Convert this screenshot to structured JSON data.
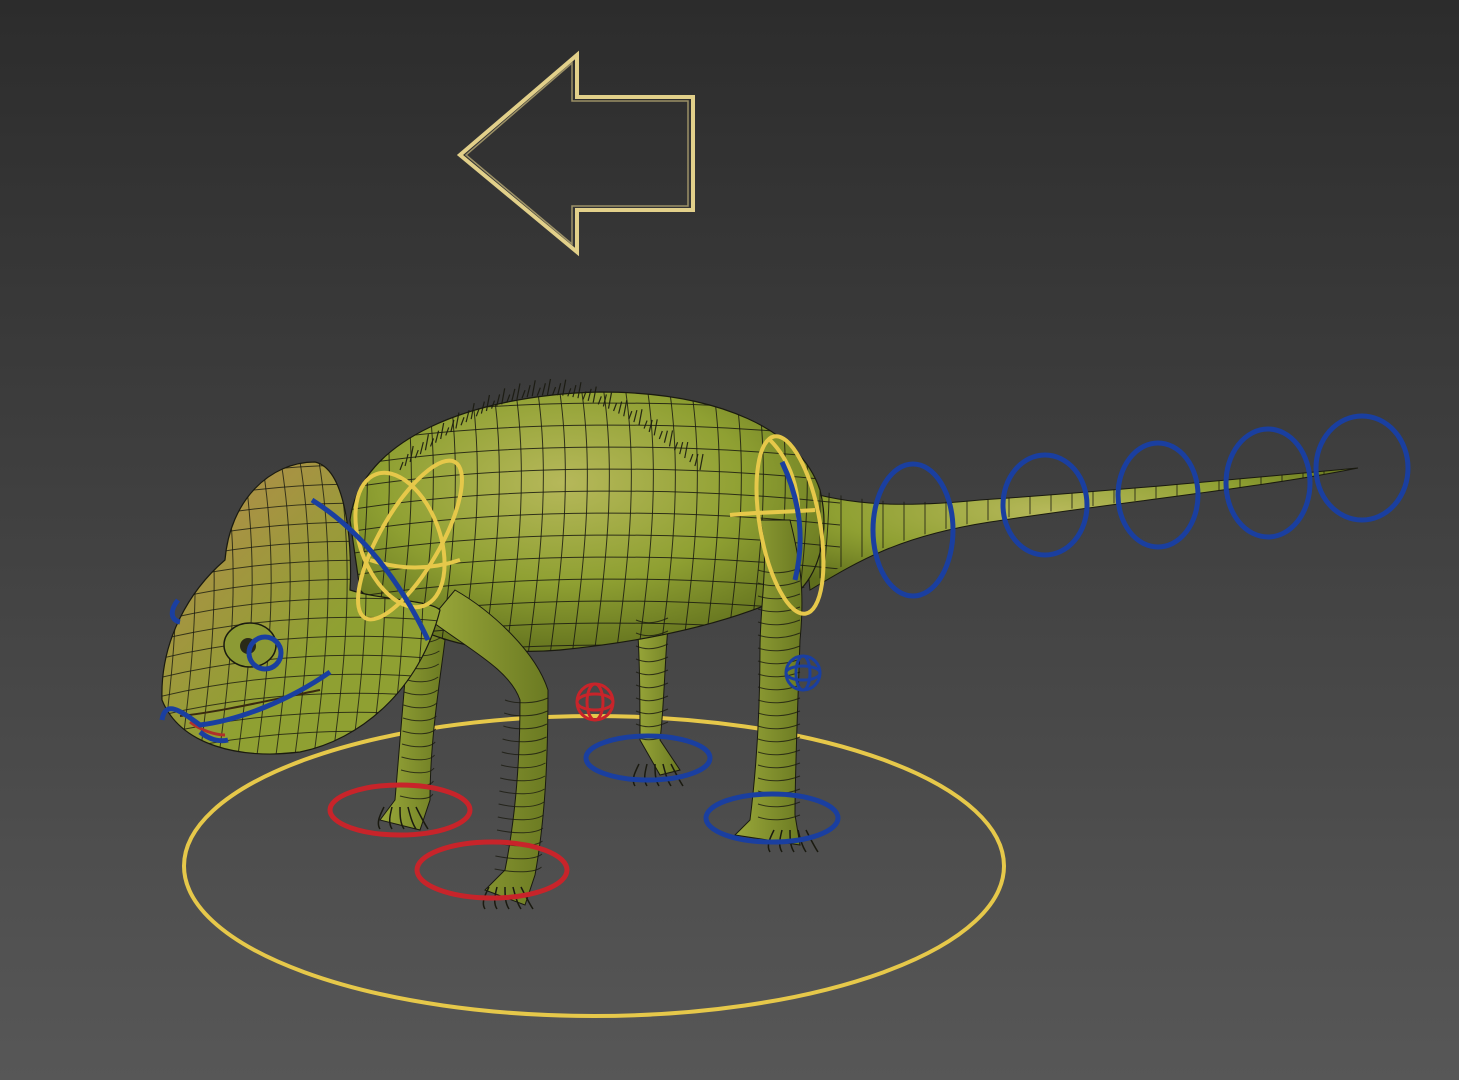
{
  "viewport": {
    "background_top": "#2c2c2c",
    "background_bottom": "#575757",
    "wireframe_color": "#1a1a10"
  },
  "rig": {
    "colors": {
      "direction_arrow": "#e2d08a",
      "root_circle": "#e6c84a",
      "spine_controls": "#e6c84a",
      "blue_controls": "#1a3fa0",
      "red_controls": "#c8242a"
    },
    "icons": {
      "direction_arrow": "left-arrow-outline-icon",
      "root": "ellipse-outline-icon",
      "foot_control": "ellipse-outline-icon",
      "pole_target": "geosphere-wire-icon"
    }
  },
  "model": {
    "subject": "chameleon",
    "skin_color_main": "#8fa032",
    "skin_color_dark": "#5e6d1c",
    "skin_color_highlight": "#b6b85a",
    "skin_color_head": "#b78a4e"
  }
}
